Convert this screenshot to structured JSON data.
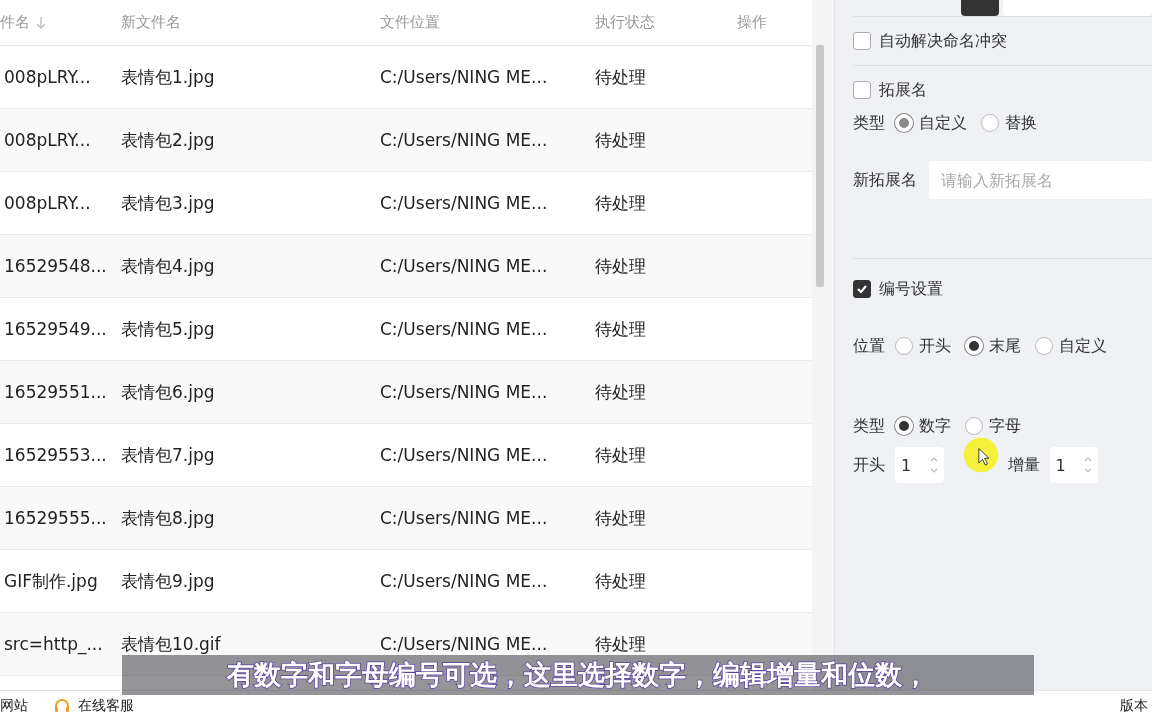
{
  "table": {
    "columns": [
      {
        "label": "件名",
        "sorted": true
      },
      {
        "label": "新文件名",
        "sorted": false
      },
      {
        "label": "文件位置",
        "sorted": false
      },
      {
        "label": "执行状态",
        "sorted": false
      },
      {
        "label": "操作",
        "sorted": false
      }
    ],
    "rows": [
      {
        "cells": [
          "008pLRY...",
          "表情包1.jpg",
          "C:/Users/NING ME...",
          "待处理"
        ]
      },
      {
        "cells": [
          "008pLRY...",
          "表情包2.jpg",
          "C:/Users/NING ME...",
          "待处理"
        ]
      },
      {
        "cells": [
          "008pLRY...",
          "表情包3.jpg",
          "C:/Users/NING ME...",
          "待处理"
        ]
      },
      {
        "cells": [
          "16529548...",
          "表情包4.jpg",
          "C:/Users/NING ME...",
          "待处理"
        ]
      },
      {
        "cells": [
          "16529549...",
          "表情包5.jpg",
          "C:/Users/NING ME...",
          "待处理"
        ]
      },
      {
        "cells": [
          "16529551...",
          "表情包6.jpg",
          "C:/Users/NING ME...",
          "待处理"
        ]
      },
      {
        "cells": [
          "16529553...",
          "表情包7.jpg",
          "C:/Users/NING ME...",
          "待处理"
        ]
      },
      {
        "cells": [
          "16529555...",
          "表情包8.jpg",
          "C:/Users/NING ME...",
          "待处理"
        ]
      },
      {
        "cells": [
          "GIF制作.jpg",
          "表情包9.jpg",
          "C:/Users/NING ME...",
          "待处理"
        ]
      },
      {
        "cells": [
          "src=http_...",
          "表情包10.gif",
          "C:/Users/NING ME...",
          "待处理"
        ]
      }
    ]
  },
  "settings": {
    "auto_resolve": {
      "label": "自动解决命名冲突",
      "checked": false
    },
    "extension": {
      "label": "拓展名",
      "checked": false,
      "type_label": "类型",
      "options": [
        {
          "label": "自定义",
          "selected": true
        },
        {
          "label": "替换",
          "selected": false
        }
      ],
      "field_label": "新拓展名",
      "placeholder": "请输入新拓展名"
    },
    "numbering": {
      "label": "编号设置",
      "checked": true,
      "position_label": "位置",
      "positions": [
        {
          "label": "开头",
          "selected": false
        },
        {
          "label": "末尾",
          "selected": true
        },
        {
          "label": "自定义",
          "selected": false
        }
      ],
      "type_label": "类型",
      "types": [
        {
          "label": "数字",
          "selected": true
        },
        {
          "label": "字母",
          "selected": false
        }
      ],
      "start_label": "开头",
      "start_value": "1",
      "step_label": "增量",
      "step_value": "1"
    }
  },
  "status_bar": {
    "items": [
      {
        "label": "网站",
        "kind": "link"
      },
      {
        "label": "在线客服",
        "kind": "support"
      }
    ],
    "version": "版本"
  },
  "subtitle": "有数字和字母编号可选，这里选择数字，编辑增量和位数，"
}
